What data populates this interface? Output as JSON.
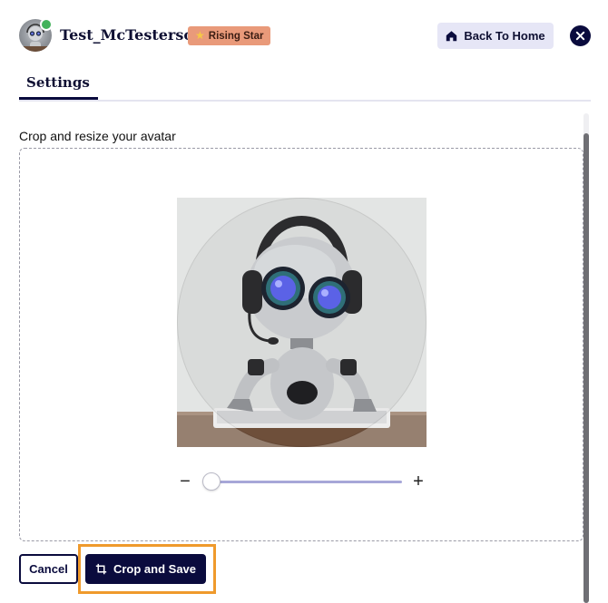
{
  "header": {
    "username": "Test_McTesterson",
    "rank_badge": "Rising Star",
    "rank_icon": "star-icon",
    "online_status_color": "#43b25b",
    "back_home_label": "Back To Home",
    "back_home_icon": "home-icon",
    "close_icon": "close-icon"
  },
  "tabs": [
    {
      "label": "Settings",
      "active": true
    }
  ],
  "avatar_editor": {
    "title": "Crop and resize your avatar",
    "zoom_level": 0.0,
    "zoom_minus_label": "−",
    "zoom_plus_label": "+",
    "cancel_label": "Cancel",
    "save_label": "Crop and Save",
    "save_icon": "crop-icon"
  },
  "colors": {
    "primary": "#0a0b3d",
    "badge": "#e99a7a",
    "back_button_bg": "#e6e6f6",
    "slider_track": "#a7a7d8",
    "highlight": "#ef9a2c"
  }
}
